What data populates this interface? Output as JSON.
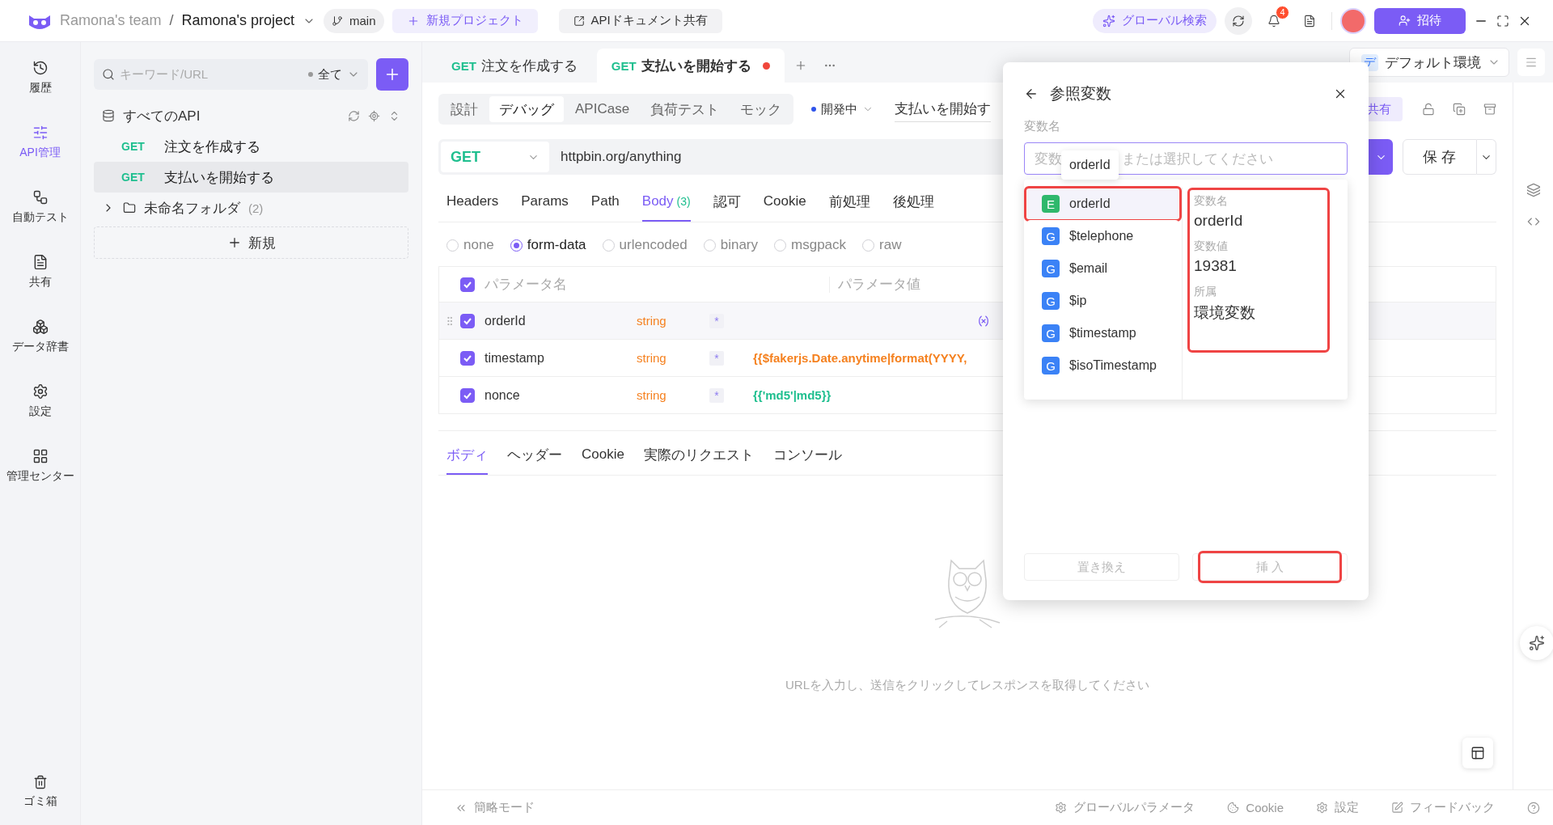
{
  "topbar": {
    "team": "Ramona's team",
    "separator": "/",
    "project": "Ramona's project",
    "branch": "main",
    "new_project": "新規プロジェクト",
    "share_docs": "APIドキュメント共有",
    "global_search": "グローバル検索",
    "notification_count": "4",
    "invite": "招待"
  },
  "nav": [
    {
      "kind": "history",
      "label": "履歴",
      "selected": false
    },
    {
      "kind": "api",
      "label": "API管理",
      "selected": true
    },
    {
      "kind": "autotest",
      "label": "自動テスト",
      "selected": false
    },
    {
      "kind": "share",
      "label": "共有",
      "selected": false
    },
    {
      "kind": "dictionary",
      "label": "データ辞書",
      "selected": false
    },
    {
      "kind": "settings",
      "label": "設定",
      "selected": false
    },
    {
      "kind": "admin",
      "label": "管理センター",
      "selected": false
    }
  ],
  "nav_bottom": {
    "label": "ゴミ箱"
  },
  "sidebar": {
    "search_placeholder": "キーワード/URL",
    "filter": "全て",
    "root": "すべてのAPI",
    "items": [
      {
        "method": "GET",
        "name": "注文を作成する",
        "selected": false
      },
      {
        "method": "GET",
        "name": "支払いを開始する",
        "selected": true
      }
    ],
    "folder": {
      "name": "未命名フォルダ",
      "count": "(2)",
      "expanded": false
    },
    "new_button": "新規"
  },
  "tabs": [
    {
      "method": "GET",
      "title": "注文を作成する",
      "selected": false,
      "unsaved": false
    },
    {
      "method": "GET",
      "title": "支払いを開始する",
      "selected": true,
      "unsaved": true
    }
  ],
  "environment": {
    "badge": "デ",
    "name": "デフォルト環境"
  },
  "modes": [
    {
      "label": "設計",
      "selected": false
    },
    {
      "label": "デバッグ",
      "selected": true
    },
    {
      "label": "APICase",
      "selected": false
    },
    {
      "label": "負荷テスト",
      "selected": false
    },
    {
      "label": "モック",
      "selected": false
    }
  ],
  "api_status": "開発中",
  "api_name": "支払いを開始す",
  "share_button": "共有",
  "request": {
    "method": "GET",
    "url": "httpbin.org/anything",
    "save": "保 存"
  },
  "request_tabs": [
    {
      "label": "Headers",
      "selected": false
    },
    {
      "label": "Params",
      "selected": false
    },
    {
      "label": "Path",
      "selected": false
    },
    {
      "label": "Body",
      "count": "(3)",
      "selected": true
    },
    {
      "label": "認可",
      "selected": false
    },
    {
      "label": "Cookie",
      "selected": false
    },
    {
      "label": "前処理",
      "selected": false
    },
    {
      "label": "後処理",
      "selected": false
    }
  ],
  "body_types": [
    {
      "label": "none",
      "selected": false
    },
    {
      "label": "form-data",
      "selected": true
    },
    {
      "label": "urlencoded",
      "selected": false
    },
    {
      "label": "binary",
      "selected": false
    },
    {
      "label": "msgpack",
      "selected": false
    },
    {
      "label": "raw",
      "selected": false
    }
  ],
  "params": {
    "all_checked": true,
    "columns": [
      "パラメータ名",
      "パラメータ値"
    ],
    "rows": [
      {
        "checked": true,
        "name": "orderId",
        "type": "string",
        "required": "*",
        "hovered": true
      },
      {
        "checked": true,
        "name": "timestamp",
        "type": "string",
        "required": "*",
        "value": "{{$fakerjs.Date.anytime|format(YYYY,",
        "color": "#f5811f",
        "hovered": false
      },
      {
        "checked": true,
        "name": "nonce",
        "type": "string",
        "required": "*",
        "value": "{{'md5'|md5}}",
        "color": "#1fbf8f",
        "hovered": false
      }
    ]
  },
  "response_tabs": [
    {
      "label": "ボディ",
      "selected": true
    },
    {
      "label": "ヘッダー",
      "selected": false
    },
    {
      "label": "Cookie",
      "selected": false
    },
    {
      "label": "実際のリクエスト",
      "selected": false
    },
    {
      "label": "コンソール",
      "selected": false
    }
  ],
  "empty_message": "URLを入力し、送信をクリックしてレスポンスを取得してください",
  "status_bar": {
    "simple_mode": "簡略モード",
    "items": [
      {
        "kind": "params",
        "label": "グローバルパラメータ"
      },
      {
        "kind": "cookie",
        "label": "Cookie"
      },
      {
        "kind": "settings",
        "label": "設定"
      },
      {
        "kind": "feedback",
        "label": "フィードバック"
      }
    ]
  },
  "dialog": {
    "title": "参照変数",
    "field_label": "変数名",
    "placeholder_parts": [
      "変数",
      "または選択してください"
    ],
    "tooltip": "orderId",
    "variables": [
      {
        "kind": "environment",
        "badge": "E",
        "name": "orderId",
        "selected": true,
        "highlighted": true
      },
      {
        "kind": "global",
        "badge": "G",
        "name": "$telephone",
        "selected": false,
        "highlighted": false
      },
      {
        "kind": "global",
        "badge": "G",
        "name": "$email",
        "selected": false,
        "highlighted": false
      },
      {
        "kind": "global",
        "badge": "G",
        "name": "$ip",
        "selected": false,
        "highlighted": false
      },
      {
        "kind": "global",
        "badge": "G",
        "name": "$timestamp",
        "selected": false,
        "highlighted": false
      },
      {
        "kind": "global",
        "badge": "G",
        "name": "$isoTimestamp",
        "selected": false,
        "highlighted": false
      }
    ],
    "detail": {
      "highlighted": true,
      "fields": [
        {
          "label": "変数名",
          "value": "orderId"
        },
        {
          "label": "変数値",
          "value": "19381"
        },
        {
          "label": "所属",
          "value": "環境変数"
        }
      ]
    },
    "buttons": [
      {
        "label": "置き換え",
        "highlighted": false
      },
      {
        "label": "挿 入",
        "highlighted": true
      }
    ]
  }
}
